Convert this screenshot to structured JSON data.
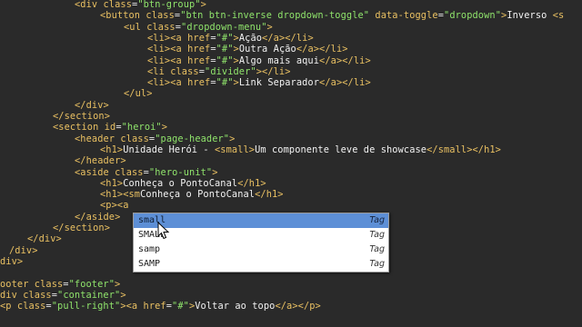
{
  "editor": {
    "lines": [
      {
        "indent": 82,
        "segments": [
          [
            "tag",
            "<div "
          ],
          [
            "attr",
            "class"
          ],
          [
            "eq",
            "="
          ],
          [
            "val",
            "\"btn-group\""
          ],
          [
            "tag",
            ">"
          ]
        ]
      },
      {
        "indent": 110,
        "segments": [
          [
            "tag",
            "<button "
          ],
          [
            "attr",
            "class"
          ],
          [
            "eq",
            "="
          ],
          [
            "val",
            "\"btn btn-inverse dropdown-toggle\""
          ],
          [
            "txt",
            " "
          ],
          [
            "attr",
            "data-toggle"
          ],
          [
            "eq",
            "="
          ],
          [
            "val",
            "\"dropdown\""
          ],
          [
            "tag",
            ">"
          ],
          [
            "txt",
            "Inverso "
          ],
          [
            "tag",
            "<s"
          ]
        ]
      },
      {
        "indent": 136,
        "segments": [
          [
            "tag",
            "<ul "
          ],
          [
            "attr",
            "class"
          ],
          [
            "eq",
            "="
          ],
          [
            "val",
            "\"dropdown-menu\""
          ],
          [
            "tag",
            ">"
          ]
        ]
      },
      {
        "indent": 162,
        "segments": [
          [
            "tag",
            "<li><a "
          ],
          [
            "attr",
            "href"
          ],
          [
            "eq",
            "="
          ],
          [
            "val",
            "\"#\""
          ],
          [
            "tag",
            ">"
          ],
          [
            "txt",
            "Ação"
          ],
          [
            "tag",
            "</a></li>"
          ]
        ]
      },
      {
        "indent": 162,
        "segments": [
          [
            "tag",
            "<li><a "
          ],
          [
            "attr",
            "href"
          ],
          [
            "eq",
            "="
          ],
          [
            "val",
            "\"#\""
          ],
          [
            "tag",
            ">"
          ],
          [
            "txt",
            "Outra Ação"
          ],
          [
            "tag",
            "</a></li>"
          ]
        ]
      },
      {
        "indent": 162,
        "segments": [
          [
            "tag",
            "<li><a "
          ],
          [
            "attr",
            "href"
          ],
          [
            "eq",
            "="
          ],
          [
            "val",
            "\"#\""
          ],
          [
            "tag",
            ">"
          ],
          [
            "txt",
            "Algo mais aqui"
          ],
          [
            "tag",
            "</a></li>"
          ]
        ]
      },
      {
        "indent": 162,
        "segments": [
          [
            "tag",
            "<li "
          ],
          [
            "attr",
            "class"
          ],
          [
            "eq",
            "="
          ],
          [
            "val",
            "\"divider\""
          ],
          [
            "tag",
            "></li>"
          ]
        ]
      },
      {
        "indent": 162,
        "segments": [
          [
            "tag",
            "<li><a "
          ],
          [
            "attr",
            "href"
          ],
          [
            "eq",
            "="
          ],
          [
            "val",
            "\"#\""
          ],
          [
            "tag",
            ">"
          ],
          [
            "txt",
            "Link Separador"
          ],
          [
            "tag",
            "</a></li>"
          ]
        ]
      },
      {
        "indent": 136,
        "segments": [
          [
            "tag",
            "</ul>"
          ]
        ]
      },
      {
        "indent": 82,
        "segments": [
          [
            "tag",
            "</div>"
          ]
        ]
      },
      {
        "indent": 58,
        "segments": [
          [
            "tag",
            "</section>"
          ]
        ]
      },
      {
        "indent": 58,
        "segments": [
          [
            "tag",
            "<section "
          ],
          [
            "attr",
            "id"
          ],
          [
            "eq",
            "="
          ],
          [
            "val",
            "\"heroi\""
          ],
          [
            "tag",
            ">"
          ]
        ]
      },
      {
        "indent": 82,
        "segments": [
          [
            "tag",
            "<header "
          ],
          [
            "attr",
            "class"
          ],
          [
            "eq",
            "="
          ],
          [
            "val",
            "\"page-header\""
          ],
          [
            "tag",
            ">"
          ]
        ]
      },
      {
        "indent": 110,
        "segments": [
          [
            "tag",
            "<h1>"
          ],
          [
            "txt",
            "Unidade Herói - "
          ],
          [
            "tag",
            "<small>"
          ],
          [
            "txt",
            "Um componente leve de showcase"
          ],
          [
            "tag",
            "</small></h1>"
          ]
        ]
      },
      {
        "indent": 82,
        "segments": [
          [
            "tag",
            "</header>"
          ]
        ]
      },
      {
        "indent": 82,
        "segments": [
          [
            "tag",
            "<aside "
          ],
          [
            "attr",
            "class"
          ],
          [
            "eq",
            "="
          ],
          [
            "val",
            "\"hero-unit\""
          ],
          [
            "tag",
            ">"
          ]
        ]
      },
      {
        "indent": 110,
        "segments": [
          [
            "tag",
            "<h1>"
          ],
          [
            "txt",
            "Conheça o PontoCanal"
          ],
          [
            "tag",
            "</h1>"
          ]
        ]
      },
      {
        "indent": 110,
        "segments": [
          [
            "tag",
            "<h1><sm"
          ],
          [
            "txt",
            "Conheça o PontoCanal"
          ],
          [
            "tag",
            "</h1>"
          ]
        ]
      },
      {
        "indent": 110,
        "segments": [
          [
            "tag",
            "<p><a "
          ],
          [
            "txt",
            "              "
          ]
        ]
      },
      {
        "indent": 82,
        "segments": [
          [
            "tag",
            "</aside>"
          ]
        ]
      },
      {
        "indent": 58,
        "segments": [
          [
            "tag",
            "</section>"
          ]
        ]
      },
      {
        "indent": 30,
        "segments": [
          [
            "tag",
            "</div>"
          ]
        ]
      },
      {
        "indent": 10,
        "segments": [
          [
            "tag",
            "/div>"
          ]
        ]
      },
      {
        "indent": 0,
        "segments": [
          [
            "tag",
            "div>"
          ]
        ]
      },
      {
        "indent": 0,
        "segments": [
          [
            "txt",
            ""
          ]
        ]
      },
      {
        "indent": 0,
        "segments": [
          [
            "tag",
            "ooter "
          ],
          [
            "attr",
            "class"
          ],
          [
            "eq",
            "="
          ],
          [
            "val",
            "\"footer\""
          ],
          [
            "tag",
            ">"
          ]
        ]
      },
      {
        "indent": 0,
        "segments": [
          [
            "tag",
            "div "
          ],
          [
            "attr",
            "class"
          ],
          [
            "eq",
            "="
          ],
          [
            "val",
            "\"container\""
          ],
          [
            "tag",
            ">"
          ]
        ]
      },
      {
        "indent": 0,
        "segments": [
          [
            "tag",
            "<p "
          ],
          [
            "attr",
            "class"
          ],
          [
            "eq",
            "="
          ],
          [
            "val",
            "\"pull-right\""
          ],
          [
            "tag",
            "><a "
          ],
          [
            "attr",
            "href"
          ],
          [
            "eq",
            "="
          ],
          [
            "val",
            "\"#\""
          ],
          [
            "tag",
            ">"
          ],
          [
            "txt",
            "Voltar ao topo"
          ],
          [
            "tag",
            "</a></p>"
          ]
        ]
      }
    ]
  },
  "autocomplete": {
    "items": [
      {
        "label": "small",
        "type": "Tag",
        "selected": true
      },
      {
        "label": "SMALL",
        "type": "Tag",
        "selected": false
      },
      {
        "label": "samp",
        "type": "Tag",
        "selected": false
      },
      {
        "label": "SAMP",
        "type": "Tag",
        "selected": false
      }
    ]
  },
  "colors": {
    "background": "#2a2a2a",
    "tag": "#e9c062",
    "value": "#8fe36b",
    "text": "#f2f2f2",
    "selection": "#5d8fd6"
  }
}
